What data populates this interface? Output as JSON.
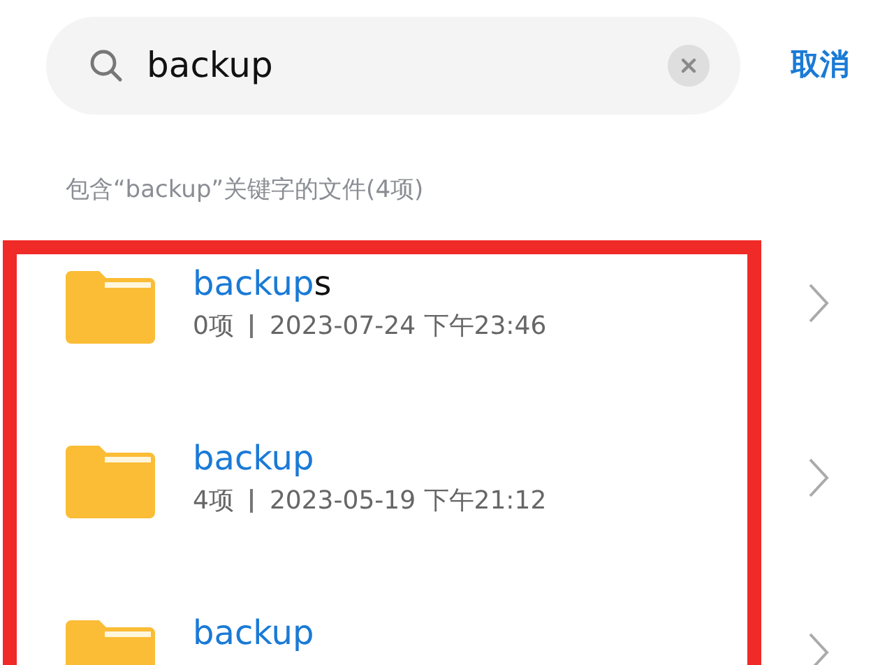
{
  "search": {
    "value": "backup",
    "clear": true
  },
  "cancel": "取消",
  "result_header": "包含“backup”关键字的文件(4项)",
  "highlight_frame": true,
  "results": [
    {
      "name_match": "backup",
      "name_rest": "s",
      "count": "0项",
      "date": "2023-07-24 下午23:46"
    },
    {
      "name_match": "backup",
      "count": "4项",
      "date": "2023-05-19 下午21:12"
    },
    {
      "name_match": "backup"
    }
  ]
}
